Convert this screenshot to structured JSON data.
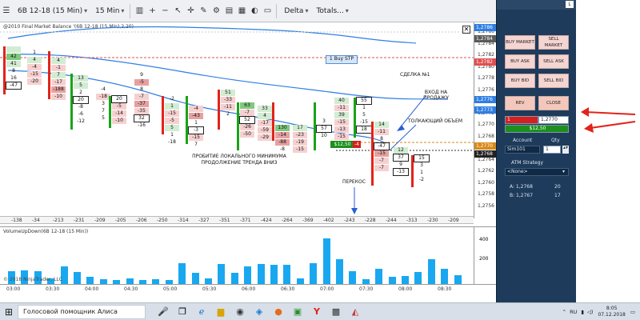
{
  "toolbar": {
    "instrument": "6B 12-18 (15 Min)",
    "interval": "15 Min",
    "indicator_label": "Delta",
    "totals_label": "Totals..."
  },
  "chart": {
    "title": "@2010 Final Market Balance  '(6B 12-18 (15 Min),2,20)",
    "order_label": "1 Buy STP",
    "annotations": {
      "deal": "СДЕЛКА №1",
      "entry_short": "ВХОД НА ПРОДАЖУ",
      "pushing_volume": "ТОЛКАЮЩИЙ ОБЪЕМ",
      "breakout_1": "ПРОБИТИЕ ЛОКАЛЬНОГО МИНИМУМА",
      "breakout_2": "ПРОДОЛЖЕНИЕ ТРЕНДА ВНИЗ",
      "skew": "ПЕРЕКОС"
    },
    "price_ticks": [
      "1,2786",
      "1,2784",
      "1,2782",
      "1,2780",
      "1,2778",
      "1,2776",
      "1,2774",
      "1,2772",
      "1,2770",
      "1,2768",
      "1,2766",
      "1,2764",
      "1,2762",
      "1,2760",
      "1,2758",
      "1,2756"
    ],
    "price_labels": {
      "current_1": "1,2786",
      "current_2": "1,2784",
      "marker_x": "1,2782",
      "blue_1": "1,2776",
      "blue_2": "1,2773",
      "orange": "1,2770",
      "black": "1,2768"
    },
    "order_price": "$12,50",
    "pnl_marker": "-4"
  },
  "delta_row": [
    "-138",
    "-34",
    "-213",
    "-231",
    "-209",
    "-205",
    "-206",
    "-250",
    "-314",
    "-327",
    "-351",
    "-371",
    "-424",
    "-264",
    "-369",
    "-402",
    "-243",
    "-228",
    "-244",
    "-313",
    "-230",
    "-209"
  ],
  "volume_panel": {
    "title": "VolumeUpDown(6B 12-18 (15 Min))",
    "copyright": "© 2018 NinjaTrader, LLC",
    "axis_labels": [
      "400",
      "200"
    ]
  },
  "time_axis": [
    "03:00",
    "03:30",
    "04:00",
    "04:30",
    "05:00",
    "05:30",
    "06:00",
    "06:30",
    "07:00",
    "07:30",
    "08:00",
    "08:30"
  ],
  "chart_data": {
    "type": "bar",
    "title": "VolumeUpDown(6B 12-18 (15 Min))",
    "ylim": [
      0,
      500
    ],
    "values": [
      130,
      140,
      130,
      60,
      180,
      120,
      70,
      50,
      40,
      60,
      40,
      50,
      40,
      210,
      110,
      60,
      200,
      110,
      180,
      200,
      190,
      190,
      60,
      210,
      460,
      250,
      130,
      50,
      150,
      70,
      80,
      120,
      250,
      150,
      90
    ]
  },
  "right_panel": {
    "buttons": {
      "buy_market": "BUY MARKET",
      "sell_market": "SELL MARKET",
      "buy_ask": "BUY ASK",
      "sell_ask": "SELL ASK",
      "buy_bid": "BUY BID",
      "sell_bid": "SELL BID",
      "rev": "REV",
      "close": "CLOSE"
    },
    "position_qty": "1",
    "position_price": "1,2770",
    "pnl": "$12,50",
    "account_label": "Account",
    "qty_label": "Qty",
    "account_value": "Sim101",
    "qty_value": "1",
    "atm_label": "ATM Strategy",
    "atm_value": "<None>",
    "ask_label": "A: 1,2768",
    "ask_size": "20",
    "bid_label": "B: 1,2767",
    "bid_size": "17"
  },
  "taskbar": {
    "search_text": "Голосовой помощник Алиса",
    "lang": "RU",
    "time": "8:05",
    "date": "07.12.2018"
  }
}
